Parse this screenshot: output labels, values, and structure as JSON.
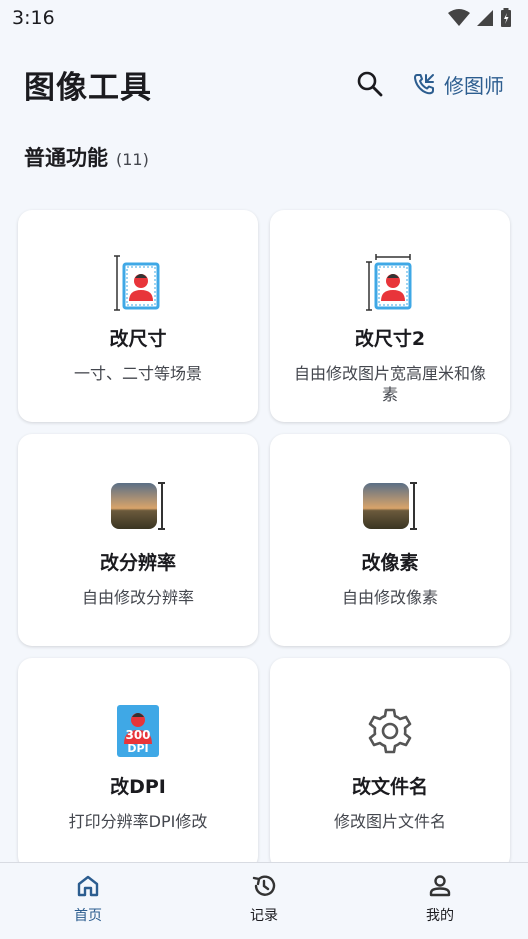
{
  "status_bar": {
    "time": "3:16"
  },
  "header": {
    "title": "图像工具",
    "retoucher_label": "修图师"
  },
  "section": {
    "title": "普通功能",
    "count": "(11)"
  },
  "cards": [
    {
      "title": "改尺寸",
      "desc": "一寸、二寸等场景",
      "icon": "id-photo-icon"
    },
    {
      "title": "改尺寸2",
      "desc": "自由修改图片宽高厘米和像素",
      "icon": "id-photo-icon"
    },
    {
      "title": "改分辨率",
      "desc": "自由修改分辨率",
      "icon": "landscape-resize-icon"
    },
    {
      "title": "改像素",
      "desc": "自由修改像素",
      "icon": "landscape-resize-icon"
    },
    {
      "title": "改DPI",
      "desc": "打印分辨率DPI修改",
      "icon": "dpi-300-icon"
    },
    {
      "title": "改文件名",
      "desc": "修改图片文件名",
      "icon": "gear-icon"
    }
  ],
  "dpi_badge": {
    "number": "300",
    "unit": "DPI"
  },
  "bottom_nav": [
    {
      "label": "首页",
      "icon": "home-icon",
      "active": true
    },
    {
      "label": "记录",
      "icon": "history-icon",
      "active": false
    },
    {
      "label": "我的",
      "icon": "person-icon",
      "active": false
    }
  ],
  "colors": {
    "accent": "#2c5d8f",
    "background": "#f4f7fc",
    "card": "#ffffff",
    "icon_blue": "#3fa8e6",
    "icon_red": "#e8353a"
  }
}
